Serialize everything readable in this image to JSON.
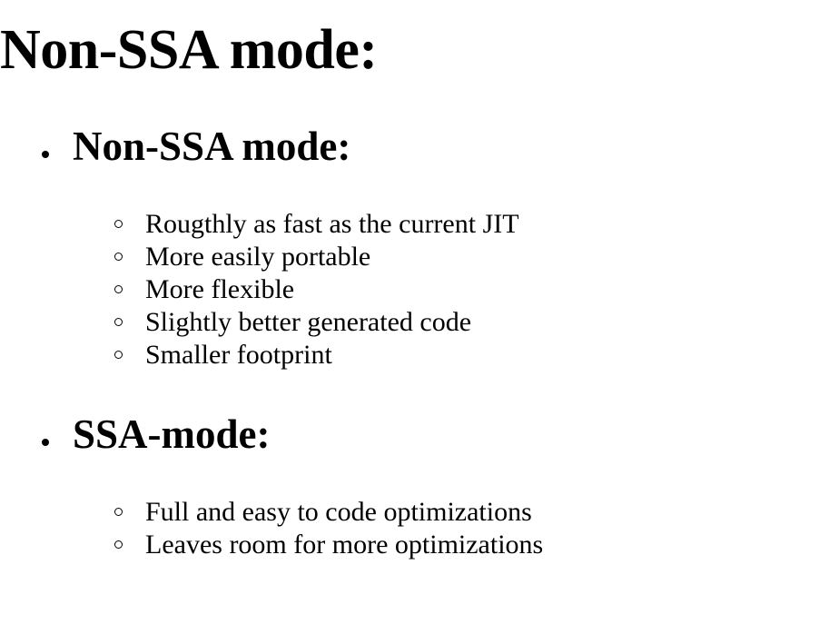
{
  "title": "Non-SSA mode:",
  "sections": [
    {
      "heading": "Non-SSA mode:",
      "items": [
        "Rougthly as fast as the current JIT",
        "More easily portable",
        "More flexible",
        "Slightly better generated code",
        "Smaller footprint"
      ]
    },
    {
      "heading": "SSA-mode:",
      "items": [
        "Full and easy to code optimizations",
        "Leaves room for more optimizations"
      ]
    }
  ]
}
